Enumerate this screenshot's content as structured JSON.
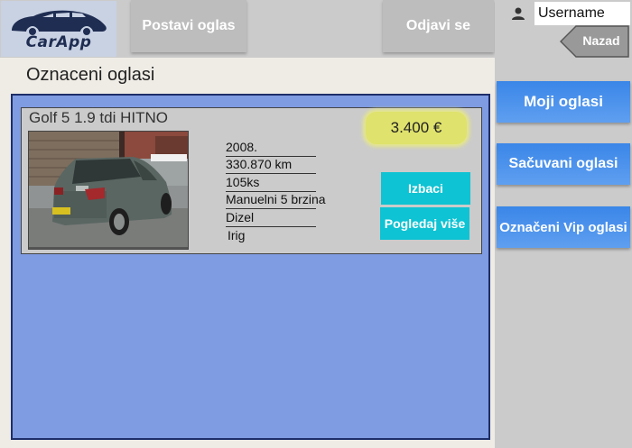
{
  "header": {
    "logo_text": "CarApp",
    "post_ad_label": "Postavi oglas",
    "logout_label": "Odjavi se"
  },
  "user": {
    "username_value": "Username"
  },
  "sidebar": {
    "back_label": "Nazad",
    "items": [
      {
        "label": "Moji oglasi"
      },
      {
        "label": "Sačuvani oglasi"
      },
      {
        "label": "Označeni Vip oglasi"
      }
    ]
  },
  "main": {
    "title": "Oznaceni oglasi",
    "listing": {
      "title": "Golf 5 1.9 tdi HITNO",
      "price": "3.400 €",
      "details": [
        "2008.",
        "330.870 km",
        "105ks",
        "Manuelni 5 brzina",
        "Dizel",
        "Irig"
      ],
      "remove_label": "Izbaci",
      "view_label": "Pogledaj više"
    }
  },
  "colors": {
    "accent_blue": "#3a86e8",
    "action_cyan": "#0ec3d3",
    "listing_bg": "#7f9be1",
    "price_highlight": "#dfe26c"
  }
}
